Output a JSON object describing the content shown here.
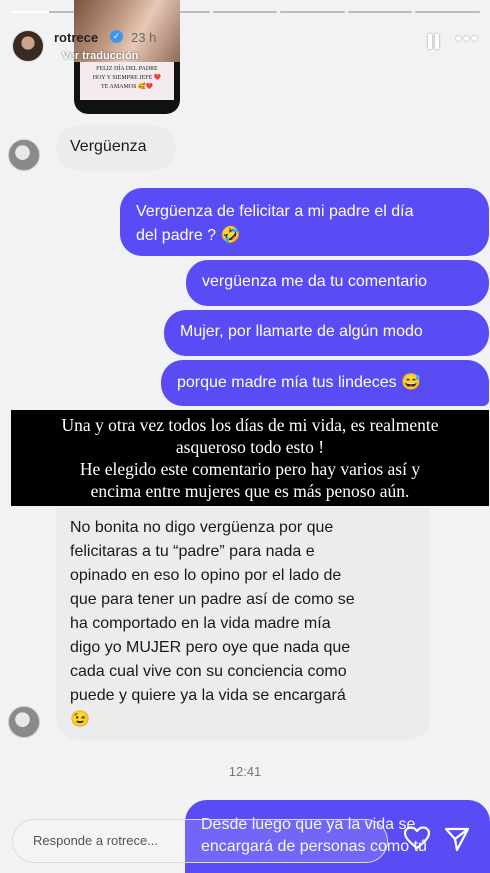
{
  "header": {
    "username": "rotrece",
    "time_ago": "23 h",
    "translate_label": "Ver traducción"
  },
  "progress": {
    "segments": 7,
    "active_index": 0,
    "active_fraction": 0.6
  },
  "shared_story": {
    "lines": [
      "FELIZ DÍA DEL PADRE",
      "HOY Y SIEMPRE JEFE ❤️",
      "TE AMAMOS 🥰❤️"
    ]
  },
  "messages": {
    "in_1": "Vergüenza",
    "out_1_line1": "Vergüenza de felicitar a mi padre el día",
    "out_1_line2": "del padre ? 🤣",
    "out_2": "vergüenza me da tu comentario",
    "out_3": "Mujer, por llamarte de algún modo",
    "out_4": "porque madre mía tus lindeces 😅",
    "in_2_lines": [
      "No bonita no digo vergüenza por que",
      "felicitaras a tu “padre” para nada e",
      "opinado en eso lo opino por el lado de",
      "que para tener un padre así de como se",
      "ha comportado en la vida madre mía",
      "digo yo MUJER pero oye que nada que",
      "cada cual vive con su conciencia como",
      "puede y quiere ya la vida se encargará",
      "😉"
    ],
    "out_5_line1": "Desde luego que ya la vida se",
    "out_5_line2": "encargará de personas como tú"
  },
  "overlay": {
    "lines": [
      "Una y otra vez todos los días de mi vida, es realmente",
      "asqueroso todo esto !",
      "He elegido este comentario pero hay varios así y",
      "encima entre mujeres que es más penoso aún."
    ]
  },
  "timestamp": "12:41",
  "reply": {
    "placeholder": "Responde a rotrece..."
  },
  "colors": {
    "outgoing_bubble": "#5a4cf5",
    "incoming_bubble": "#ececee",
    "background": "#f2f2f4"
  }
}
